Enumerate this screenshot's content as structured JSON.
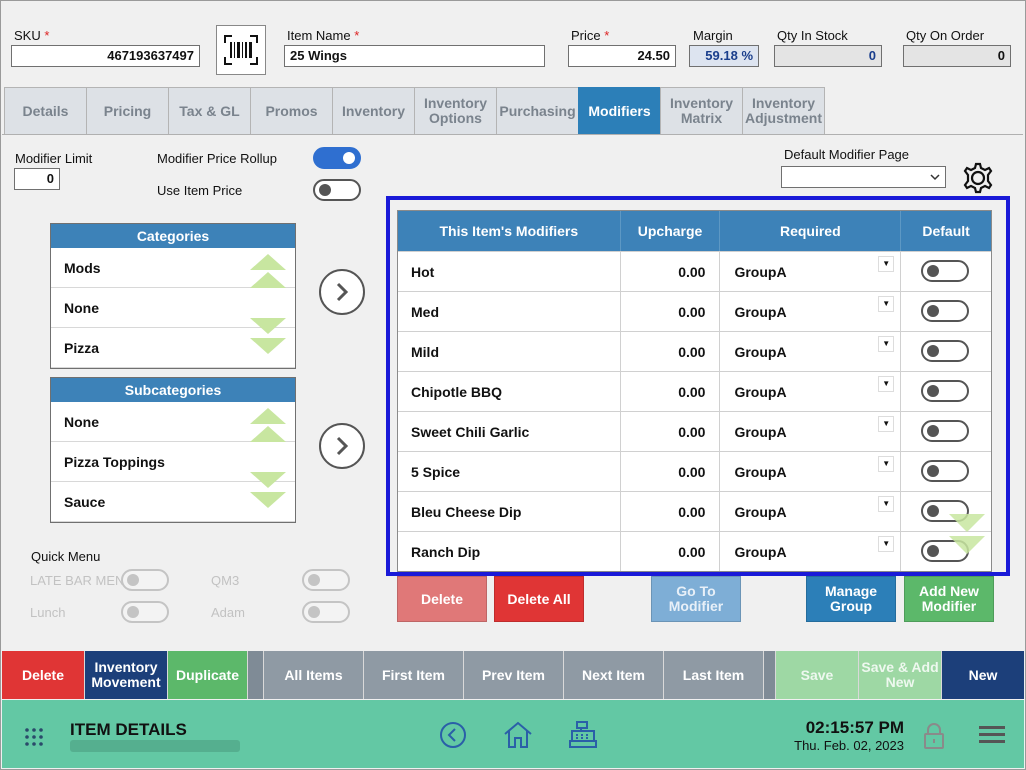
{
  "header": {
    "sku_label": "SKU",
    "sku_value": "467193637497",
    "item_name_label": "Item Name",
    "item_name_value": "25 Wings",
    "price_label": "Price",
    "price_value": "24.50",
    "margin_label": "Margin",
    "margin_value": "59.18 %",
    "qty_in_stock_label": "Qty In Stock",
    "qty_in_stock_value": "0",
    "qty_on_order_label": "Qty On Order",
    "qty_on_order_value": "0",
    "required_mark": "*"
  },
  "tabs": [
    {
      "label": "Details"
    },
    {
      "label": "Pricing"
    },
    {
      "label": "Tax & GL"
    },
    {
      "label": "Promos"
    },
    {
      "label": "Inventory"
    },
    {
      "label": "Inventory Options"
    },
    {
      "label": "Purchasing"
    },
    {
      "label": "Modifiers",
      "active": true
    },
    {
      "label": "Inventory Matrix"
    },
    {
      "label": "Inventory Adjustment"
    }
  ],
  "modifier_settings": {
    "modifier_limit_label": "Modifier Limit",
    "modifier_limit_value": "0",
    "price_rollup_label": "Modifier Price Rollup",
    "price_rollup_on": true,
    "use_item_price_label": "Use Item Price",
    "use_item_price_on": false,
    "default_page_label": "Default Modifier Page",
    "default_page_value": ""
  },
  "categories": {
    "title": "Categories",
    "items": [
      "Mods",
      "None",
      "Pizza"
    ]
  },
  "subcategories": {
    "title": "Subcategories",
    "items": [
      "None",
      "Pizza Toppings",
      "Sauce"
    ]
  },
  "quick_menu": {
    "title": "Quick Menu",
    "items": [
      {
        "label": "LATE BAR MENU"
      },
      {
        "label": "QM3"
      },
      {
        "label": "Lunch"
      },
      {
        "label": "Adam"
      }
    ]
  },
  "modifiers_table": {
    "columns": [
      "This Item's Modifiers",
      "Upcharge",
      "Required",
      "Default"
    ],
    "rows": [
      {
        "name": "Hot",
        "upcharge": "0.00",
        "required": "GroupA",
        "default": false
      },
      {
        "name": "Med",
        "upcharge": "0.00",
        "required": "GroupA",
        "default": false
      },
      {
        "name": "Mild",
        "upcharge": "0.00",
        "required": "GroupA",
        "default": false
      },
      {
        "name": "Chipotle BBQ",
        "upcharge": "0.00",
        "required": "GroupA",
        "default": false
      },
      {
        "name": "Sweet Chili Garlic",
        "upcharge": "0.00",
        "required": "GroupA",
        "default": false
      },
      {
        "name": "5 Spice",
        "upcharge": "0.00",
        "required": "GroupA",
        "default": false
      },
      {
        "name": "Bleu Cheese Dip",
        "upcharge": "0.00",
        "required": "GroupA",
        "default": false
      },
      {
        "name": "Ranch Dip",
        "upcharge": "0.00",
        "required": "GroupA",
        "default": false
      }
    ]
  },
  "modifier_actions": {
    "delete": "Delete",
    "delete_all": "Delete All",
    "go_to_modifier": "Go To Modifier",
    "manage_group": "Manage Group",
    "add_new_modifier": "Add New Modifier"
  },
  "toolbar": {
    "delete": "Delete",
    "inventory_movement": "Inventory Movement",
    "duplicate": "Duplicate",
    "all_items": "All Items",
    "first_item": "First Item",
    "prev_item": "Prev Item",
    "next_item": "Next Item",
    "last_item": "Last Item",
    "save": "Save",
    "save_add_new": "Save & Add New",
    "new": "New"
  },
  "status_bar": {
    "title": "ITEM DETAILS",
    "time": "02:15:57 PM",
    "date": "Thu. Feb. 02, 2023"
  },
  "colors": {
    "accent_blue": "#3d82b8",
    "active_tab": "#2c7fb8",
    "highlight_border": "#1a1ad8",
    "status_bar": "#63c8a4",
    "delete_red": "#e03535",
    "add_green": "#5cb86a"
  }
}
